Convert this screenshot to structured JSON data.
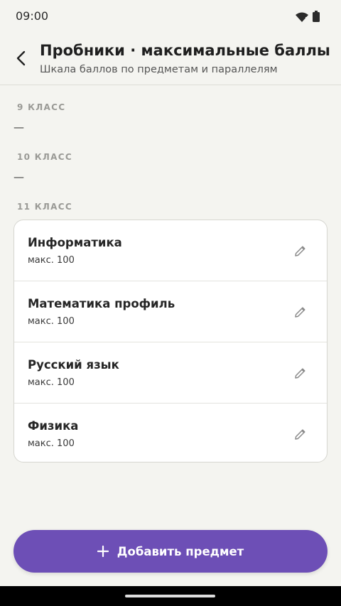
{
  "status_bar": {
    "time": "09:00"
  },
  "header": {
    "title": "Пробники · максимальные баллы",
    "subtitle": "Шкала баллов по предметам и параллелям"
  },
  "grades": [
    {
      "label": "9 КЛАСС",
      "empty_text": "—"
    },
    {
      "label": "10 КЛАСС",
      "empty_text": "—"
    },
    {
      "label": "11 КЛАСС"
    }
  ],
  "subjects": [
    {
      "name": "Информатика",
      "max": "макс. 100"
    },
    {
      "name": "Математика профиль",
      "max": "макс. 100"
    },
    {
      "name": "Русский язык",
      "max": "макс. 100"
    },
    {
      "name": "Физика",
      "max": "макс. 100"
    }
  ],
  "fab": {
    "label": "Добавить предмет"
  },
  "colors": {
    "accent": "#6d4fb6",
    "background": "#f4f4f0"
  }
}
